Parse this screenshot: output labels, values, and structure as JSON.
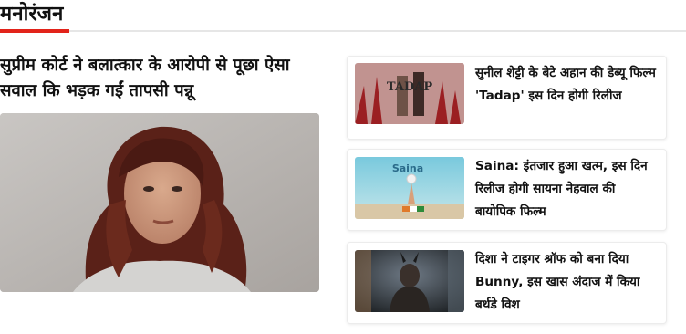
{
  "section": {
    "title": "मनोरंजन",
    "accent_color": "#e2231a"
  },
  "lead": {
    "headline": "सुप्रीम कोर्ट ने बलात्कार के आरोपी से पूछा ऐसा सवाल कि भड़क गईं तापसी पन्नू",
    "image_icon": "portrait-photo"
  },
  "cards": [
    {
      "title": "सुनील शेट्टी के बेटे अहान की डेब्यू फिल्म 'Tadap' इस दिन होगी रिलीज",
      "thumb_text": "TADAP",
      "thumb_icon": "movie-poster-photo"
    },
    {
      "title": "Saina: इंतजार हुआ खत्म, इस दिन रिलीज होगी सायना नेहवाल की बायोपिक फिल्म",
      "thumb_text": "Saina",
      "thumb_icon": "movie-poster-photo"
    },
    {
      "title": "दिशा ने टाइगर श्रॉफ को बना दिया Bunny, इस खास अंदाज में किया बर्थडे विश",
      "thumb_icon": "portrait-photo"
    }
  ]
}
